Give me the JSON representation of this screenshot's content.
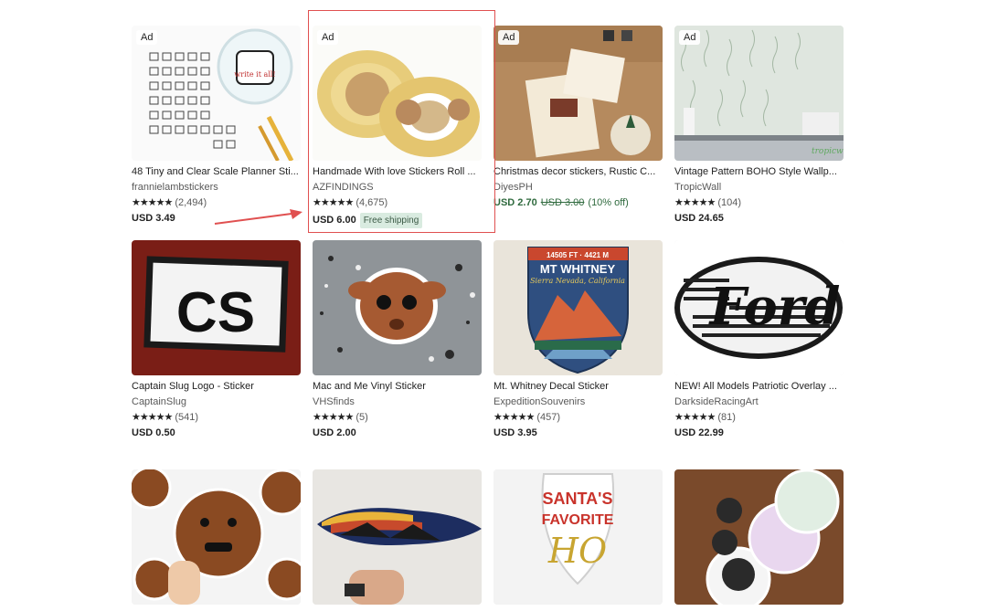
{
  "listings": [
    {
      "title": "48 Tiny and Clear Scale Planner Sti...",
      "shop": "frannielambstickers",
      "rating": "★★★★★",
      "reviews": "(2,494)",
      "price": "USD 3.49",
      "ad": "Ad"
    },
    {
      "title": "Handmade With love Stickers Roll ...",
      "shop": "AZFINDINGS",
      "rating": "★★★★★",
      "reviews": "(4,675)",
      "price": "USD 6.00",
      "badge": "Free shipping",
      "ad": "Ad"
    },
    {
      "title": "Christmas decor stickers, Rustic C...",
      "shop": "DiyesPH",
      "rating": "",
      "reviews": "",
      "price": "USD 2.70",
      "orig_price": "USD 3.00",
      "discount": "(10% off)",
      "ad": "Ad"
    },
    {
      "title": "Vintage Pattern BOHO Style Wallp...",
      "shop": "TropicWall",
      "rating": "★★★★★",
      "reviews": "(104)",
      "price": "USD 24.65",
      "ad": "Ad"
    },
    {
      "title": "Captain Slug Logo - Sticker",
      "shop": "CaptainSlug",
      "rating": "★★★★★",
      "reviews": "(541)",
      "price": "USD 0.50"
    },
    {
      "title": "Mac and Me Vinyl Sticker",
      "shop": "VHSfinds",
      "rating": "★★★★★",
      "reviews": "(5)",
      "price": "USD 2.00"
    },
    {
      "title": "Mt. Whitney Decal Sticker",
      "shop": "ExpeditionSouvenirs",
      "rating": "★★★★★",
      "reviews": "(457)",
      "price": "USD 3.95"
    },
    {
      "title": "NEW! All Models Patriotic Overlay ...",
      "shop": "DarksideRacingArt",
      "rating": "★★★★★",
      "reviews": "(81)",
      "price": "USD 22.99"
    }
  ],
  "images": {
    "scale_text": "write it all!",
    "whitney_top": "14505 FT · 4421 M",
    "whitney_title": "MT WHITNEY",
    "whitney_sub": "Sierra Nevada, California",
    "santa_line1": "SANTA'S",
    "santa_line2": "FAVORITE",
    "santa_line3": "HO",
    "cs_text": "CS",
    "ford_text": "Ford",
    "tropic_text": "tropicwall"
  },
  "colors": {
    "highlight": "#e05050",
    "sale_green": "#2f6a3e",
    "badge_bg": "#d9ebe0"
  }
}
